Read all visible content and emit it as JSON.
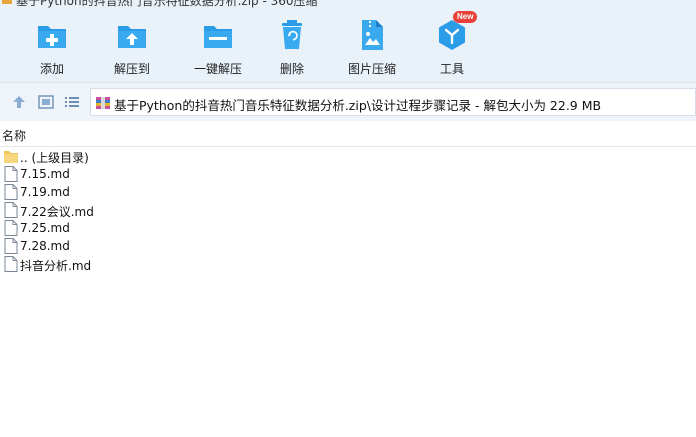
{
  "window": {
    "title": "基于Python的抖音热门音乐特征数据分析.zip - 360压缩"
  },
  "toolbar": {
    "items": [
      {
        "label": "添加",
        "icon": "add-icon"
      },
      {
        "label": "解压到",
        "icon": "extract-to-icon"
      },
      {
        "label": "一键解压",
        "icon": "one-click-extract-icon"
      },
      {
        "label": "删除",
        "icon": "delete-icon"
      },
      {
        "label": "图片压缩",
        "icon": "image-compress-icon"
      },
      {
        "label": "工具",
        "icon": "tools-icon",
        "badge": "New"
      }
    ]
  },
  "addressbar": {
    "path": "基于Python的抖音热门音乐特征数据分析.zip\\设计过程步骤记录 - 解包大小为 22.9 MB"
  },
  "list": {
    "column_name": "名称",
    "rows": [
      {
        "name": ".. (上级目录)",
        "icon": "folder-icon"
      },
      {
        "name": "7.15.md",
        "icon": "file-icon"
      },
      {
        "name": "7.19.md",
        "icon": "file-icon"
      },
      {
        "name": "7.22会议.md",
        "icon": "file-icon"
      },
      {
        "name": "7.25.md",
        "icon": "file-icon"
      },
      {
        "name": "7.28.md",
        "icon": "file-icon"
      },
      {
        "name": "抖音分析.md",
        "icon": "file-icon"
      }
    ]
  },
  "colors": {
    "accent": "#2b9de8",
    "toolbar_bg": "#e9f1f9",
    "badge": "#e8413a"
  }
}
